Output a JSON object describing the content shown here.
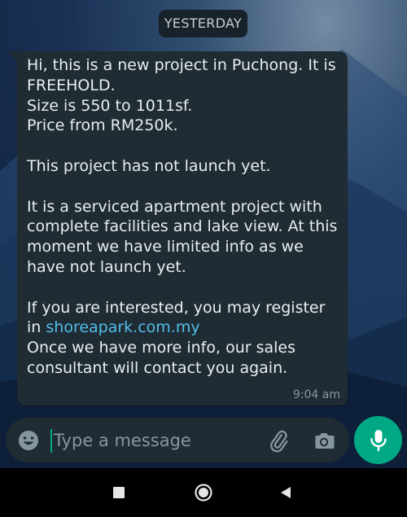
{
  "date_chip": "YESTERDAY",
  "message": {
    "text_before_link": "Hi, this is a new project in Puchong. It is FREEHOLD.\nSize is 550 to 1011sf.\nPrice from RM250k.\n\nThis project has not launch yet.\n\nIt is a serviced apartment project with complete facilities and lake view. At this moment we have limited info as we have not launch yet.\n\nIf you are interested, you may register in ",
    "link": "shoreapark.com.my",
    "text_after_link": "\nOnce we have more info, our sales consultant will contact you again.",
    "time": "9:04 am"
  },
  "composer": {
    "placeholder": "Type a message",
    "emoji_icon": "emoji-icon",
    "attach_icon": "paperclip-icon",
    "camera_icon": "camera-icon",
    "mic_icon": "microphone-icon"
  },
  "colors": {
    "accent": "#00a884",
    "bubble": "#1f2c33",
    "link": "#53bdeb"
  },
  "nav": {
    "recent_icon": "recent-apps-icon",
    "home_icon": "home-icon",
    "back_icon": "back-icon"
  }
}
